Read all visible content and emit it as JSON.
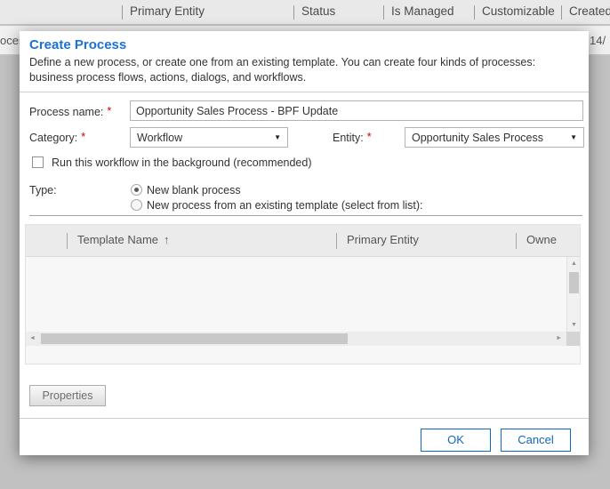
{
  "background": {
    "columns": [
      "Primary Entity",
      "Status",
      "Is Managed",
      "Customizable",
      "Created"
    ],
    "partial_row_left": "oces",
    "partial_row_right": "14/"
  },
  "dialog": {
    "title": "Create Process",
    "description": "Define a new process, or create one from an existing template. You can create four kinds of processes: business process flows, actions, dialogs, and workflows.",
    "required_mark": "*",
    "fields": {
      "process_name": {
        "label": "Process name:",
        "value": "Opportunity Sales Process - BPF Update"
      },
      "category": {
        "label": "Category:",
        "value": "Workflow"
      },
      "entity": {
        "label": "Entity:",
        "value": "Opportunity Sales Process"
      },
      "run_in_background": {
        "label": "Run this workflow in the background (recommended)",
        "checked": false
      },
      "type": {
        "label": "Type:",
        "options": [
          {
            "label": "New blank process",
            "selected": true
          },
          {
            "label": "New process from an existing template (select from list):",
            "selected": false
          }
        ]
      }
    },
    "template_grid": {
      "columns": [
        "Template Name",
        "Primary Entity",
        "Owne"
      ],
      "sort_arrow": "↑",
      "rows": []
    },
    "buttons": {
      "properties": "Properties",
      "ok": "OK",
      "cancel": "Cancel"
    }
  },
  "icons": {
    "dropdown_arrow": "▼",
    "scroll_up": "▲",
    "scroll_down": "▼",
    "scroll_left": "◄",
    "scroll_right": "►"
  },
  "colors": {
    "title_blue": "#1b70dd",
    "button_blue": "#1268bd",
    "required_red": "#cc0000",
    "overlay_gray": "#c1c1c1"
  }
}
